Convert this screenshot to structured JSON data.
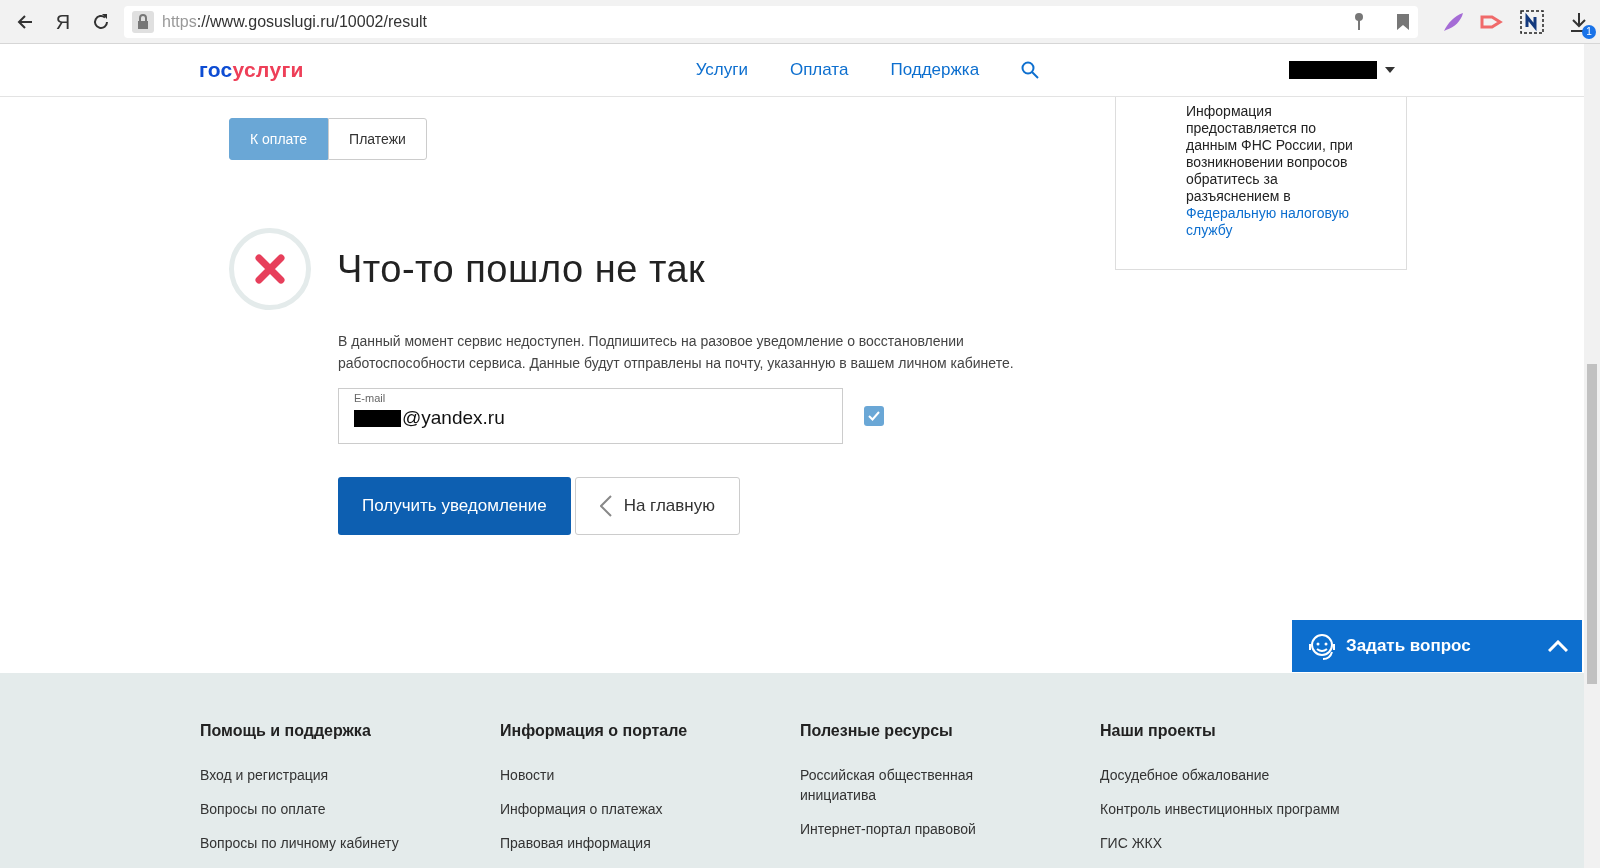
{
  "browser": {
    "yandex_button": "Я",
    "url_scheme": "https",
    "url_rest": "://www.gosuslugi.ru/10002/result",
    "download_badge": "1"
  },
  "header": {
    "logo_part_1": "гос",
    "logo_part_2": "услуги",
    "nav": [
      {
        "label": "Услуги"
      },
      {
        "label": "Оплата"
      },
      {
        "label": "Поддержка"
      }
    ]
  },
  "tabs": [
    {
      "label": "К оплате",
      "selected": true
    },
    {
      "label": "Платежи",
      "selected": false
    }
  ],
  "info_box": {
    "text": "Информация предоставляется по данным ФНС России, при возникновении вопросов обратитесь за разъяснением в",
    "link": "Федеральную налоговую службу"
  },
  "error": {
    "title": "Что-то пошло не так",
    "message": "В данный момент сервис недоступен. Подпишитесь на разовое уведомление о восстановлении работоспособности сервиса. Данные будут отправлены на почту, указанную в вашем личном кабинете."
  },
  "email_field": {
    "label": "E-mail",
    "value": "@yandex.ru",
    "checked": true
  },
  "buttons": [
    {
      "kind": "primary",
      "label": "Получить уведомление"
    },
    {
      "kind": "back",
      "label": "На главную"
    }
  ],
  "chat_button": {
    "label": "Задать вопрос"
  },
  "footer": {
    "columns": [
      {
        "heading": "Помощь и поддержка",
        "links": [
          "Вход и регистрация",
          "Вопросы по оплате",
          "Вопросы по личному кабинету"
        ]
      },
      {
        "heading": "Информация о портале",
        "links": [
          "Новости",
          "Информация о платежах",
          "Правовая информация"
        ]
      },
      {
        "heading": "Полезные ресурсы",
        "links": [
          "Российская общественная инициатива",
          "Интернет-портал правовой"
        ]
      },
      {
        "heading": "Наши проекты",
        "links": [
          "Досудебное обжалование",
          "Контроль инвестиционных программ",
          "ГИС ЖКХ"
        ]
      }
    ]
  }
}
